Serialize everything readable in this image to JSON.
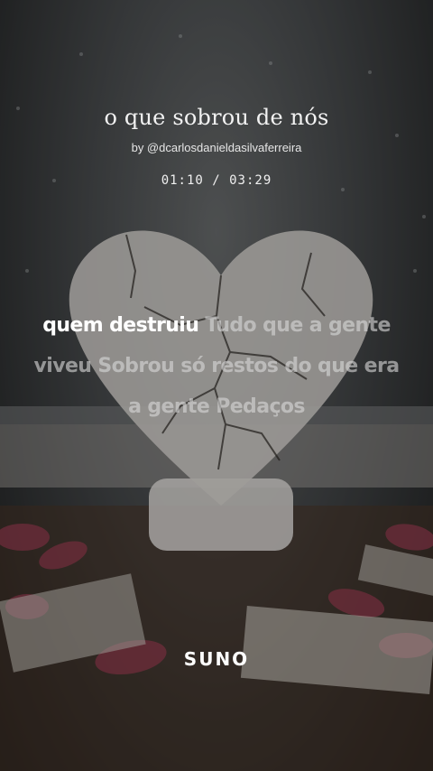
{
  "song": {
    "title": "o que sobrou de nós",
    "artist_line": "by @dcarlosdanieldasilvaferreira"
  },
  "player": {
    "time_display": "01:10 / 03:29"
  },
  "lyrics": {
    "active_text": "quem destruiu",
    "upcoming_text": "Tudo que a gente viveu Sobrou só restos do que era a gente Pedaços"
  },
  "brand": {
    "logo": "SUNO"
  },
  "colors": {
    "active_lyric": "#ffffff",
    "inactive_lyric": "#bfbfbf",
    "overlay": "#000000"
  }
}
